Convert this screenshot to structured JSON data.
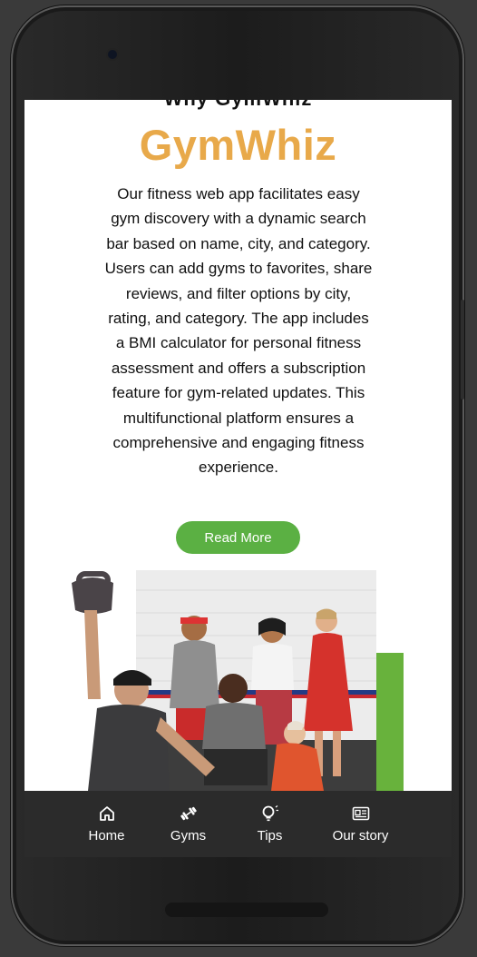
{
  "app": {
    "cut_heading": "Why GymWhiz",
    "brand": "GymWhiz",
    "brand_color": "#e8a94a",
    "description": "Our fitness web app facilitates easy gym discovery with a dynamic search bar based on name, city, and category. Users can add gyms to favorites, share reviews, and filter options by city, rating, and category. The app includes a BMI calculator for personal fitness assessment and offers a subscription feature for gym-related updates. This multifunctional platform ensures a comprehensive and engaging fitness experience.",
    "read_more_label": "Read More",
    "accent_color": "#5bb043"
  },
  "nav": {
    "items": [
      {
        "label": "Home",
        "icon": "home-icon"
      },
      {
        "label": "Gyms",
        "icon": "dumbbell-icon"
      },
      {
        "label": "Tips",
        "icon": "lightbulb-icon"
      },
      {
        "label": "Our story",
        "icon": "newspaper-icon"
      }
    ]
  }
}
